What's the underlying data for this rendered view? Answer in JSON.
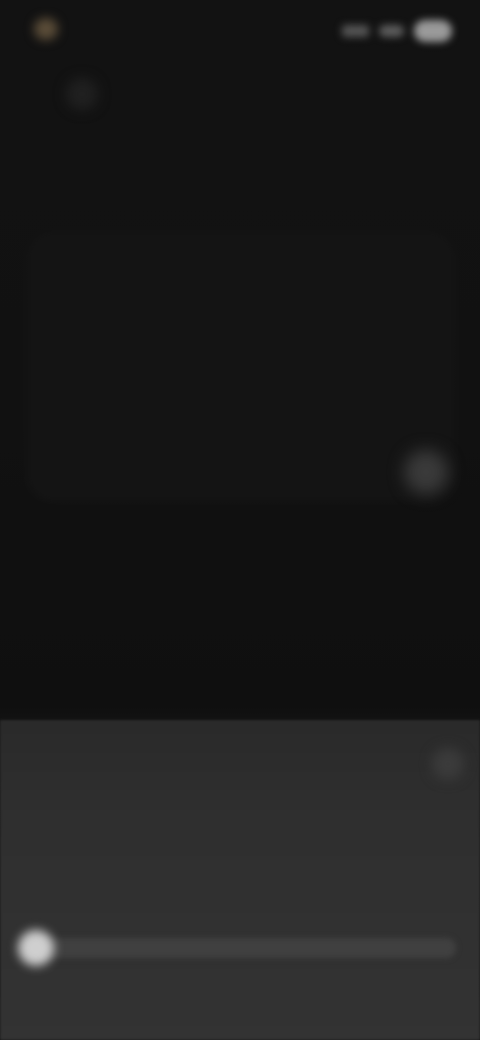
{
  "status_bar": {
    "time": "",
    "icons": [
      "signal-icon",
      "wifi-icon",
      "battery-icon"
    ]
  },
  "header": {
    "back_icon": "chevron-left-icon",
    "title": ""
  },
  "card": {
    "title": "",
    "body": "",
    "action_icon": "circle-icon"
  },
  "sheet": {
    "title": "",
    "close_icon": "close-icon",
    "label": "",
    "sublabel": "",
    "slider": {
      "value": 0.0
    }
  },
  "colors": {
    "background": "#101010",
    "card": "#141414",
    "sheet": "#333333",
    "accent": "#b9a98e",
    "thumb": "#cfcfcf"
  }
}
